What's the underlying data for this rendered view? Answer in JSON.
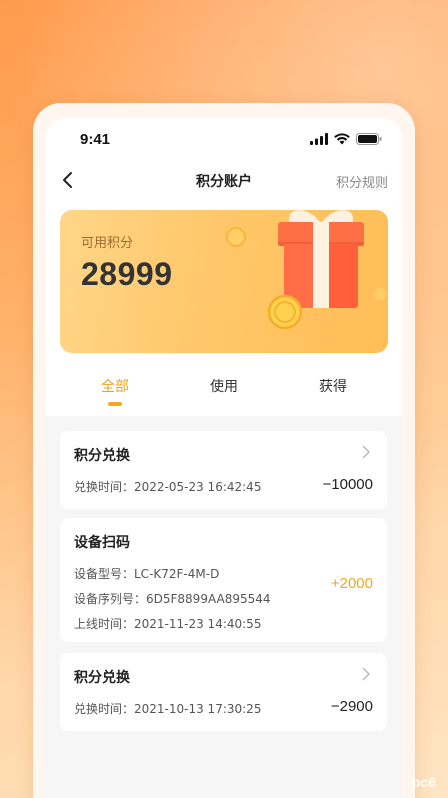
{
  "status_bar": {
    "time": "9:41"
  },
  "nav": {
    "title": "积分账户",
    "right_link": "积分规则"
  },
  "points": {
    "label": "可用积分",
    "value": "28999"
  },
  "tabs": [
    {
      "label": "全部",
      "active": true
    },
    {
      "label": "使用",
      "active": false
    },
    {
      "label": "获得",
      "active": false
    }
  ],
  "records": [
    {
      "title": "积分兑换",
      "lines": [
        "兑换时间：2022-05-23 16:42:45"
      ],
      "amount": "−10000"
    },
    {
      "title": "设备扫码",
      "lines": [
        "设备型号：LC-K72F-4M-D",
        "设备序列号：6D5F8899AA895544",
        "上线时间：2021-11-23 14:40:55"
      ],
      "amount": "+2000"
    },
    {
      "title": "积分兑换",
      "lines": [
        "兑换时间：2021-10-13 17:30:25"
      ],
      "amount": "−2900"
    }
  ],
  "colors": {
    "accent": "#f5a623",
    "card_gradient_start": "#ffd688",
    "card_gradient_end": "#ffbd56",
    "background": "#ff9a4d"
  },
  "icons": [
    "signal-icon",
    "wifi-icon",
    "battery-icon",
    "back-arrow-icon",
    "gift-box-icon",
    "coin-icon",
    "chevron-right-icon"
  ],
  "watermark": "pc6"
}
